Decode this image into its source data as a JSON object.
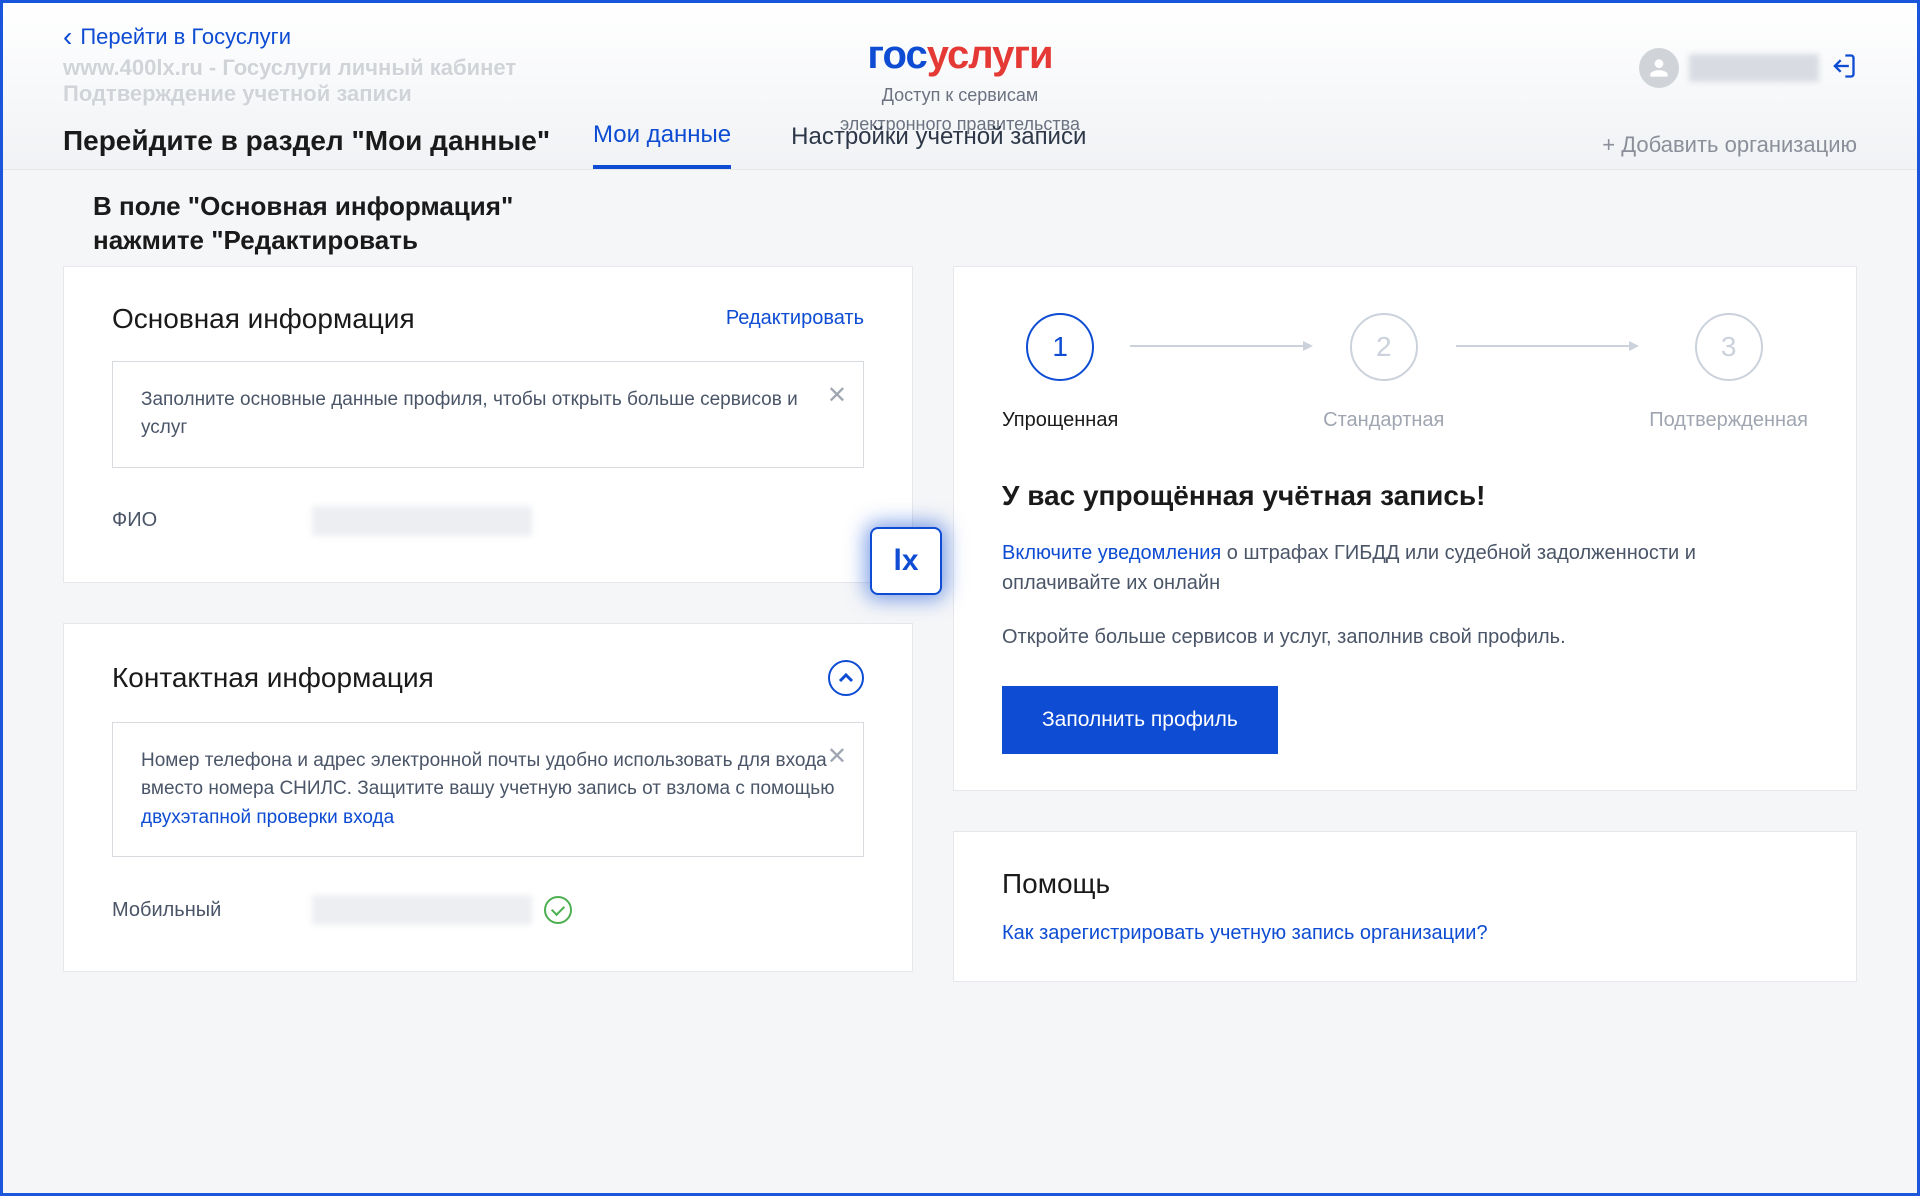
{
  "header": {
    "back_link": "Перейти в Госуслуги",
    "watermark_line1": "www.400lx.ru - Госуслуги личный кабинет",
    "watermark_line2": "Подтверждение учетной записи",
    "logo_part1": "гос",
    "logo_part2": "услуги",
    "logo_sub1": "Доступ к сервисам",
    "logo_sub2": "электронного правительства",
    "instruction": "Перейдите в раздел \"Мои данные\"",
    "sub_instruction1": "В поле \"Основная информация\"",
    "sub_instruction2": "нажмите \"Редактировать",
    "add_org": "+ Добавить организацию"
  },
  "tabs": [
    {
      "label": "Мои данные",
      "active": true
    },
    {
      "label": "Настройки учетной записи",
      "active": false
    }
  ],
  "main_info": {
    "title": "Основная информация",
    "edit": "Редактировать",
    "notice": "Заполните основные данные профиля, чтобы открыть больше сервисов и услуг",
    "field_fio": "ФИО",
    "watermark_badge": "lx"
  },
  "contact_info": {
    "title": "Контактная информация",
    "notice_part1": "Номер телефона и адрес электронной почты удобно использовать для входа вместо номера СНИЛС. Защитите вашу учетную запись от взлома с помощью ",
    "notice_link": "двухэтапной проверки входа",
    "field_mobile": "Мобильный"
  },
  "account_level": {
    "steps": [
      {
        "num": "1",
        "label": "Упрощенная",
        "active": true
      },
      {
        "num": "2",
        "label": "Стандартная",
        "active": false
      },
      {
        "num": "3",
        "label": "Подтвержденная",
        "active": false
      }
    ],
    "status_title": "У вас упрощённая учётная запись!",
    "notify_link": "Включите уведомления",
    "notify_rest": " о штрафах ГИБДД или судебной задолженности и оплачивайте их онлайн",
    "more_text": "Откройте больше сервисов и услуг, заполнив свой профиль.",
    "button": "Заполнить профиль"
  },
  "help": {
    "title": "Помощь",
    "link1": "Как зарегистрировать учетную запись организации?"
  }
}
